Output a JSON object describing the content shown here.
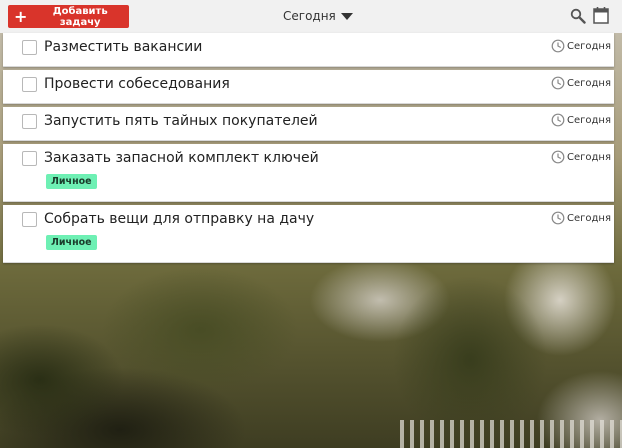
{
  "toolbar": {
    "add_task_label": "Добавить задачу",
    "date_filter": "Сегодня"
  },
  "colors": {
    "accent": "#d9342b",
    "tag": "#6ef0b4"
  },
  "icons": [
    "plus-icon",
    "chevron-down-icon",
    "search-icon",
    "calendar-icon",
    "clock-icon"
  ],
  "tasks": [
    {
      "title": "Разместить вакансии",
      "due": "Сегодня"
    },
    {
      "title": "Провести собеседования",
      "due": "Сегодня"
    },
    {
      "title": "Запустить пять тайных покупателей",
      "due": "Сегодня"
    },
    {
      "title": "Заказать запасной комплект ключей",
      "due": "Сегодня",
      "tag": "Личное"
    },
    {
      "title": "Собрать вещи для отправку на дачу",
      "due": "Сегодня",
      "tag": "Личное"
    }
  ]
}
